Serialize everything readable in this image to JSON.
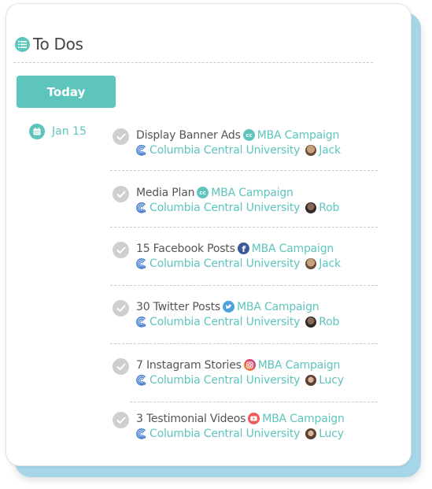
{
  "header": {
    "title": "To Dos",
    "icon": "list-icon"
  },
  "today_button": {
    "label": "Today"
  },
  "date_group": {
    "label": "Jan 15",
    "icon": "calendar-icon"
  },
  "colors": {
    "accent": "#5ec5bc",
    "backing": "#a6d5e8",
    "check": "#cfcfcf",
    "facebook": "#3b5998",
    "twitter": "#4aa3df",
    "instagram": "#e8505b",
    "youtube": "#ef5b5b"
  },
  "tasks": [
    {
      "name": "Display Banner Ads",
      "channel_icon": "cc-icon",
      "campaign": "MBA Campaign",
      "client": "Columbia Central University",
      "assignee": "Jack"
    },
    {
      "name": "Media Plan",
      "channel_icon": "cc-icon",
      "campaign": "MBA Campaign",
      "client": "Columbia Central University",
      "assignee": "Rob"
    },
    {
      "name": "15 Facebook Posts",
      "channel_icon": "facebook-icon",
      "campaign": "MBA Campaign",
      "client": "Columbia Central University",
      "assignee": "Jack"
    },
    {
      "name": "30 Twitter Posts",
      "channel_icon": "twitter-icon",
      "campaign": "MBA Campaign",
      "client": "Columbia Central University",
      "assignee": "Rob"
    },
    {
      "name": "7 Instagram Stories",
      "channel_icon": "instagram-icon",
      "campaign": "MBA Campaign",
      "client": "Columbia Central University",
      "assignee": "Lucy"
    },
    {
      "name": "3 Testimonial Videos",
      "channel_icon": "youtube-icon",
      "campaign": "MBA Campaign",
      "client": "Columbia Central University",
      "assignee": "Lucy"
    }
  ]
}
